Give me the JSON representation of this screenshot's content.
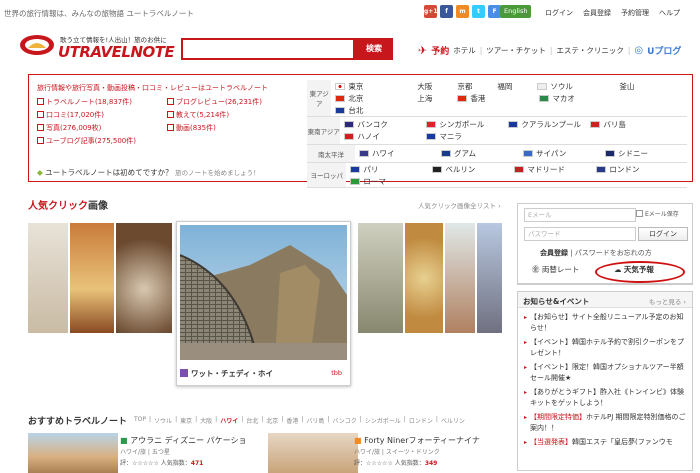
{
  "top": {
    "tagline": "世界の旅行情報は、みんなの旅物語 ユートラベルノート",
    "social": [
      {
        "label": "g+1",
        "color": "#d34836",
        "icon": "google-plus-icon"
      },
      {
        "label": "f",
        "color": "#3b5998",
        "icon": "facebook-icon"
      },
      {
        "label": "m",
        "color": "#f08a24",
        "icon": "mixi-icon"
      },
      {
        "label": "t",
        "color": "#33ccff",
        "icon": "twitter-icon"
      },
      {
        "label": "F",
        "color": "#4a90e2",
        "icon": "feed-icon"
      }
    ],
    "english": "English",
    "links": [
      "ログイン",
      "会員登録",
      "予約管理",
      "ヘルプ"
    ]
  },
  "header": {
    "logo_sub": "歌う立て情報を!人出山！旅のお供に",
    "logo_text": "UTRAVELNOTE",
    "search_btn": "検索",
    "nav_yoyaku": "予約",
    "nav_items": [
      "ホテル",
      "ツアー・チケット",
      "エステ・クリニック"
    ],
    "uplog": "Uプログ"
  },
  "mainbox": {
    "title": "旅行情報や旅行写真・動画投稿・口コミ・レビューはユートラベルノート",
    "stats": [
      "トラベルノート(18,837件)",
      "ブログレビュー(26,231件)",
      "口コミ(17,020件)",
      "教えて(5,214件)",
      "写真(276,009枚)",
      "動画(835件)",
      "ユーブログ記事(275,500件)",
      ""
    ],
    "first_time": "ユートラベルノートは初めてですか？",
    "first_time_sub": "旅のノートを始めましょう！",
    "regions": [
      {
        "name": "東アジア",
        "cities": [
          {
            "label": "東京",
            "flag": "japan"
          },
          {
            "label": "大阪",
            "flag": ""
          },
          {
            "label": "京都",
            "flag": ""
          },
          {
            "label": "福岡",
            "flag": ""
          },
          {
            "label": "ソウル",
            "flag": "korea"
          },
          {
            "label": "釜山",
            "flag": ""
          },
          {
            "label": "北京",
            "flag": "china"
          },
          {
            "label": "上海",
            "flag": ""
          },
          {
            "label": "香港",
            "flag": "hongkong"
          },
          {
            "label": "マカオ",
            "flag": "macau"
          },
          {
            "label": "台北",
            "flag": "taiwan"
          }
        ]
      },
      {
        "name": "東南アジア",
        "cities": [
          {
            "label": "バンコク",
            "flag": "thai"
          },
          {
            "label": "シンガポール",
            "flag": "singapore"
          },
          {
            "label": "クアラルンプール",
            "flag": "malaysia"
          },
          {
            "label": "バリ島",
            "flag": "indonesia"
          },
          {
            "label": "ハノイ",
            "flag": "vietnam"
          },
          {
            "label": "マニラ",
            "flag": "phil"
          }
        ]
      },
      {
        "name": "南太平洋",
        "cities": [
          {
            "label": "ハワイ",
            "flag": "usa"
          },
          {
            "label": "グアム",
            "flag": "guam"
          },
          {
            "label": "サイパン",
            "flag": "saipan"
          },
          {
            "label": "シドニー",
            "flag": "aus"
          }
        ]
      },
      {
        "name": "ヨーロッパ",
        "cities": [
          {
            "label": "パリ",
            "flag": "france"
          },
          {
            "label": "ベルリン",
            "flag": "germany"
          },
          {
            "label": "マドリード",
            "flag": "spain"
          },
          {
            "label": "ロンドン",
            "flag": "uk"
          },
          {
            "label": "ローマ",
            "flag": "italy"
          }
        ]
      }
    ]
  },
  "popular": {
    "title_a": "人気クリック",
    "title_b": "画像",
    "more": "人気クリック画像全リスト ›",
    "caption": "ワット・チェディ・ホイ",
    "tag": "tbb"
  },
  "recommend": {
    "title": "おすすめトラベルノート",
    "tabs": [
      "TOP",
      "ソウル",
      "東京",
      "大阪",
      "ハワイ",
      "台北",
      "北京",
      "香港",
      "バリ島",
      "バンコク",
      "シンガポール",
      "ロンドン",
      "ベルリン"
    ],
    "active_tab": "ハワイ",
    "cards": [
      {
        "title": "アウラニ ディズニー パケーショ",
        "sub": "ハワイ/旅 | 五つ星",
        "eval": "評：☆☆☆☆☆ 人気指数：",
        "score": "471"
      },
      {
        "title": "Forty Ninerフォーティーナイナ",
        "sub": "ハワイ/旅 | スイーツ・ドリンク",
        "eval": "評：☆☆☆☆☆ 人気指数：",
        "score": "349"
      }
    ]
  },
  "login": {
    "email_ph": "Eメール",
    "pw_ph": "パスワード",
    "save": "Eメール保存",
    "login_btn": "ログイン",
    "register": "会員登録",
    "forgot": " | パスワードをお忘れの方",
    "exchange": "両替レート",
    "weather": "天気予報"
  },
  "news": {
    "title": "お知らせ&イベント",
    "more": "もっと見る ›",
    "items": [
      {
        "tag": "",
        "text": "【お知らせ】サイト全般リニューアル予定のお知らせ！"
      },
      {
        "tag": "",
        "text": "【イベント】韓国ホテル予約で割引クーポンをプレゼント！"
      },
      {
        "tag": "",
        "text": "【イベント】限定！韓国オプショナルツアー半額セール開催★"
      },
      {
        "tag": "",
        "text": "【ありがとうギフト】酢入社《トンインビ》体験キットをゲットしよう！"
      },
      {
        "tag": "【期間限定特価】",
        "text": "ホテルPJ 期間限定特別価格のご案内！！"
      },
      {
        "tag": "【当選発表】",
        "text": "韓国エステ「皇后夢(ファンウモ"
      }
    ]
  },
  "colors": {
    "brand": "#c8161d"
  }
}
